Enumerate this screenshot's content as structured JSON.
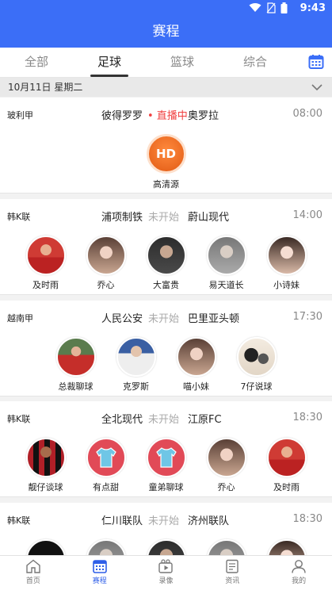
{
  "status_bar": {
    "time": "9:43",
    "icons": [
      "wifi-icon",
      "no-sim-icon",
      "battery-icon"
    ]
  },
  "header": {
    "title": "赛程"
  },
  "tabs": [
    {
      "label": "全部",
      "active": false
    },
    {
      "label": "足球",
      "active": true
    },
    {
      "label": "篮球",
      "active": false
    },
    {
      "label": "综合",
      "active": false
    }
  ],
  "date_bar": {
    "date": "10月11日 星期二"
  },
  "matches": [
    {
      "league": "玻利甲",
      "home": "彼得罗罗",
      "status": "• 直播中",
      "away": "奥罗拉",
      "time": "08:00",
      "streams": [
        {
          "label": "高清源",
          "type": "hd",
          "badge": "HD"
        }
      ]
    },
    {
      "league": "韩K联",
      "home": "浦项制铁",
      "status": "未开始",
      "away": "蔚山现代",
      "time": "14:00",
      "streams": [
        {
          "label": "及时雨"
        },
        {
          "label": "乔心"
        },
        {
          "label": "大富贵"
        },
        {
          "label": "易天道长"
        },
        {
          "label": "小诗妹"
        }
      ]
    },
    {
      "league": "越南甲",
      "home": "人民公安",
      "status": "未开始",
      "away": "巴里亚头顿",
      "time": "17:30",
      "streams": [
        {
          "label": "总裁聊球"
        },
        {
          "label": "克罗斯"
        },
        {
          "label": "喵小妹"
        },
        {
          "label": "7仔说球"
        }
      ]
    },
    {
      "league": "韩K联",
      "home": "全北现代",
      "status": "未开始",
      "away": "江原FC",
      "time": "18:30",
      "streams": [
        {
          "label": "靓仔谈球"
        },
        {
          "label": "有点甜"
        },
        {
          "label": "童弟聊球"
        },
        {
          "label": "乔心"
        },
        {
          "label": "及时雨"
        }
      ]
    },
    {
      "league": "韩K联",
      "home": "仁川联队",
      "status": "未开始",
      "away": "济州联队",
      "time": "18:30",
      "streams": []
    }
  ],
  "bottom_nav": [
    {
      "label": "首页",
      "icon": "home-icon",
      "active": false
    },
    {
      "label": "赛程",
      "icon": "calendar-icon",
      "active": true
    },
    {
      "label": "录像",
      "icon": "video-icon",
      "active": false
    },
    {
      "label": "资讯",
      "icon": "news-icon",
      "active": false
    },
    {
      "label": "我的",
      "icon": "profile-icon",
      "active": false
    }
  ],
  "colors": {
    "brand": "#3b6ef7",
    "live": "#f04040",
    "hd": "#e15a14",
    "nav_active": "#2f5fe8"
  }
}
